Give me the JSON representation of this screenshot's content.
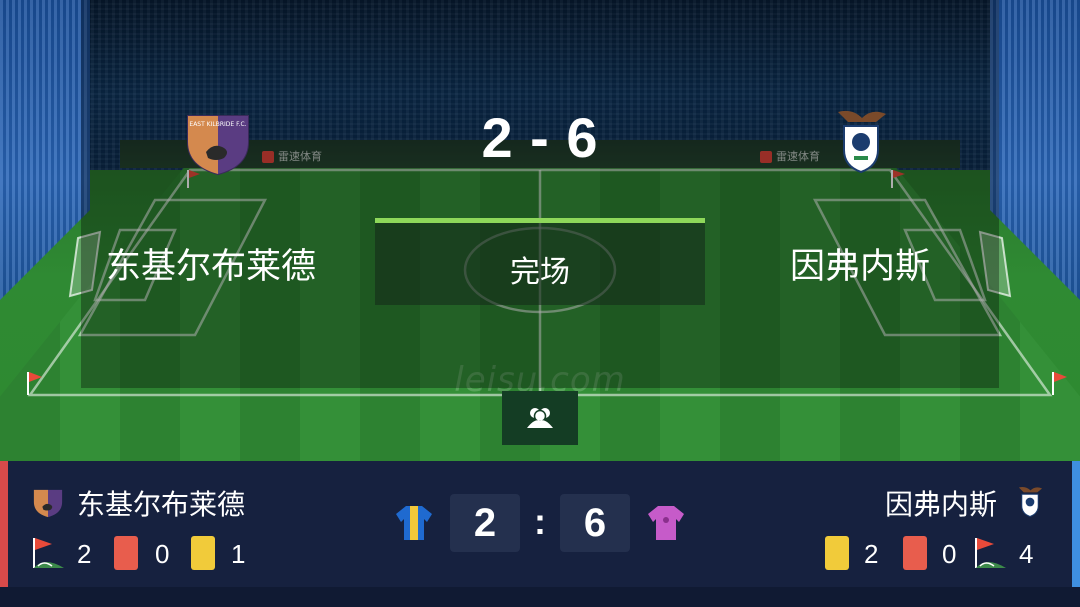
{
  "match": {
    "score_display": "2 - 6",
    "status": "完场",
    "watermark": "leisu.com",
    "sponsor_text": "雷速体育"
  },
  "home": {
    "name": "东基尔布莱德",
    "badge_text": "EAST KILBRIDE F.C.",
    "score": "2",
    "corners": "2",
    "red_cards": "0",
    "yellow_cards": "1",
    "kit_color": "#1f6ad0",
    "kit_accent": "#f2c83a"
  },
  "away": {
    "name": "因弗内斯",
    "score": "6",
    "yellow_cards": "2",
    "red_cards": "0",
    "corners": "4",
    "kit_color": "#c65bc9"
  },
  "bar": {
    "colon": ":"
  },
  "colors": {
    "status_accent": "#8ed85a",
    "red_card": "#e85d4d",
    "yellow_card": "#f1cb3a",
    "home_edge": "#d84a4a",
    "away_edge": "#3f8fe0"
  }
}
